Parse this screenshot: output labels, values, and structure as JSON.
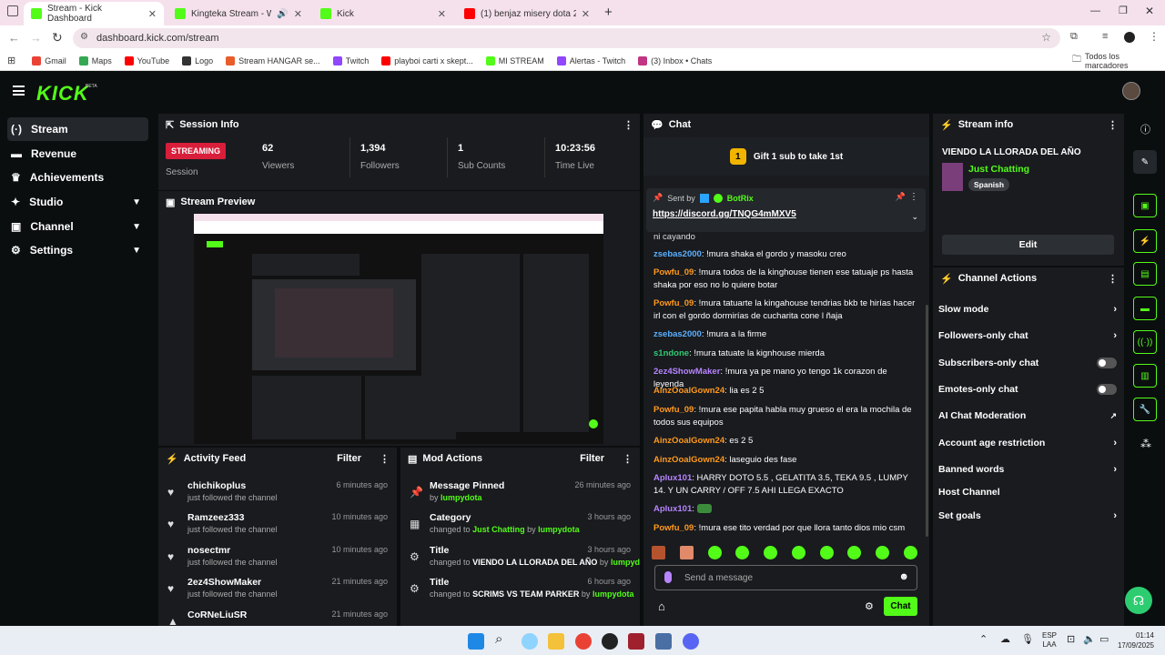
{
  "browser": {
    "tabs": [
      {
        "title": "Stream - Kick Dashboard",
        "color": "#53fc18"
      },
      {
        "title": "Kingteka Stream - Watch Li",
        "color": "#53fc18"
      },
      {
        "title": "Kick",
        "color": "#53fc18"
      },
      {
        "title": "(1) benjaz misery dota 2 11k - Y",
        "color": "#ff0000"
      }
    ],
    "url": "dashboard.kick.com/stream",
    "bookmarks": [
      {
        "label": "Gmail",
        "color": "#ea4335"
      },
      {
        "label": "Maps",
        "color": "#34a853"
      },
      {
        "label": "YouTube",
        "color": "#ff0000"
      },
      {
        "label": "Logo",
        "color": "#333333"
      },
      {
        "label": "Stream HANGAR se...",
        "color": "#e85d2a"
      },
      {
        "label": "Twitch",
        "color": "#9146ff"
      },
      {
        "label": "playboi carti x skept...",
        "color": "#ff0000"
      },
      {
        "label": "MI STREAM",
        "color": "#53fc18"
      },
      {
        "label": "Alertas - Twitch",
        "color": "#9146ff"
      },
      {
        "label": "(3) Inbox • Chats",
        "color": "#c13584"
      }
    ],
    "all_bookmarks": "Todos los marcadores"
  },
  "kick": {
    "logo": "KICK",
    "beta": "BETA"
  },
  "sidebar": {
    "items": [
      {
        "label": "Stream"
      },
      {
        "label": "Revenue"
      },
      {
        "label": "Achievements"
      },
      {
        "label": "Studio"
      },
      {
        "label": "Channel"
      },
      {
        "label": "Settings"
      }
    ]
  },
  "session": {
    "title": "Session Info",
    "status": "STREAMING",
    "session_label": "Session",
    "stats": [
      {
        "value": "62",
        "label": "Viewers"
      },
      {
        "value": "1,394",
        "label": "Followers"
      },
      {
        "value": "1",
        "label": "Sub Counts"
      },
      {
        "value": "10:23:56",
        "label": "Time Live"
      }
    ]
  },
  "preview": {
    "title": "Stream Preview"
  },
  "activity": {
    "title": "Activity Feed",
    "filter": "Filter",
    "items": [
      {
        "name": "chichikoplus",
        "action": "just followed the channel",
        "time": "6 minutes ago"
      },
      {
        "name": "Ramzeez333",
        "action": "just followed the channel",
        "time": "10 minutes ago"
      },
      {
        "name": "nosectmr",
        "action": "just followed the channel",
        "time": "10 minutes ago"
      },
      {
        "name": "2ez4ShowMaker",
        "action": "just followed the channel",
        "time": "21 minutes ago"
      },
      {
        "name": "CoRNeLiuSR",
        "action": "",
        "time": "21 minutes ago"
      }
    ]
  },
  "mod": {
    "title": "Mod Actions",
    "filter": "Filter",
    "items": [
      {
        "title": "Message Pinned",
        "pre": "by",
        "bold": "",
        "green": "lumpydota",
        "mid": "",
        "by": "",
        "time": "26 minutes ago"
      },
      {
        "title": "Category",
        "pre": "changed to",
        "bold": "",
        "green": "Just Chatting",
        "mid": "by",
        "by": "lumpydota",
        "time": "3 hours ago"
      },
      {
        "title": "Title",
        "pre": "changed to",
        "bold": "VIENDO LA LLORADA DEL AÑO",
        "green": "",
        "mid": "by",
        "by": "lumpydota",
        "time": "3 hours ago"
      },
      {
        "title": "Title",
        "pre": "changed to",
        "bold": "SCRIMS VS TEAM PARKER",
        "green": "",
        "mid": "by",
        "by": "lumpydota",
        "time": "6 hours ago"
      }
    ]
  },
  "chat": {
    "title": "Chat",
    "gift": "Gift 1 sub to take 1st",
    "gift_count": "1",
    "pinned_sent_by": "Sent by",
    "pinned_user": "BotRix",
    "pinned_link": "https://discord.gg/TNQG4mMXV5",
    "top_partial": "ni cayando",
    "messages": [
      {
        "user": "zsebas2000",
        "color": "#5ab0ff",
        "text": "!mura shaka el gordo y masoku creo"
      },
      {
        "user": "Powfu_09",
        "color": "#ff9a1f",
        "text": "!mura todos de la kinghouse tienen ese tatuaje ps hasta shaka por eso no lo quiere botar"
      },
      {
        "user": "Powfu_09",
        "color": "#ff9a1f",
        "text": "!mura tatuarte la kingahouse tendrias bkb te hirías hacer irl con el gordo dormirías de cucharita cone l ñaja"
      },
      {
        "user": "zsebas2000",
        "color": "#5ab0ff",
        "text": "!mura a la firme"
      },
      {
        "user": "s1ndone",
        "color": "#2ecc71",
        "text": "!mura tatuate la kignhouse mierda"
      },
      {
        "user": "2ez4ShowMaker",
        "color": "#b884ff",
        "text": "!mura ya pe mano yo tengo 1k corazon de leyenda"
      },
      {
        "user": "AinzOoalGown24",
        "color": "#ff9a1f",
        "text": "lia es 2 5"
      },
      {
        "user": "Powfu_09",
        "color": "#ff9a1f",
        "text": "!mura ese papita habla muy grueso el era la mochila de todos sus equipos"
      },
      {
        "user": "AinzOoalGown24",
        "color": "#ff9a1f",
        "text": "es 2 5"
      },
      {
        "user": "AinzOoalGown24",
        "color": "#ff9a1f",
        "text": "laseguio des fase"
      },
      {
        "user": "Aplux101",
        "color": "#b884ff",
        "text": "HARRY DOTO 5.5 , GELATITA 3.5, TEKA 9.5 , LUMPY 14. Y UN CARRY / OFF 7.5 AHI LLEGA EXACTO"
      },
      {
        "user": "Aplux101",
        "color": "#b884ff",
        "text": ""
      },
      {
        "user": "Powfu_09",
        "color": "#ff9a1f",
        "text": "!mura ese tito verdad por que llora tanto dios mio csm"
      }
    ],
    "placeholder": "Send a message",
    "send": "Chat"
  },
  "stream_info": {
    "title": "Stream info",
    "stream_title": "VIENDO LA LLORADA DEL AÑO",
    "category": "Just Chatting",
    "language": "Spanish",
    "edit": "Edit"
  },
  "channel_actions": {
    "title": "Channel Actions",
    "items": [
      {
        "label": "Slow mode"
      },
      {
        "label": "Followers-only chat"
      },
      {
        "label": "Subscribers-only chat"
      },
      {
        "label": "Emotes-only chat"
      },
      {
        "label": "AI Chat Moderation"
      },
      {
        "label": "Account age restriction"
      },
      {
        "label": "Banned words"
      },
      {
        "label": "Host Channel"
      },
      {
        "label": "Set goals"
      }
    ]
  },
  "taskbar": {
    "lang": "ESP",
    "lang2": "LAA",
    "time": "01:14",
    "date": "17/09/2025"
  },
  "colors": {
    "accent": "#53fc18",
    "live": "#d81e3b"
  }
}
